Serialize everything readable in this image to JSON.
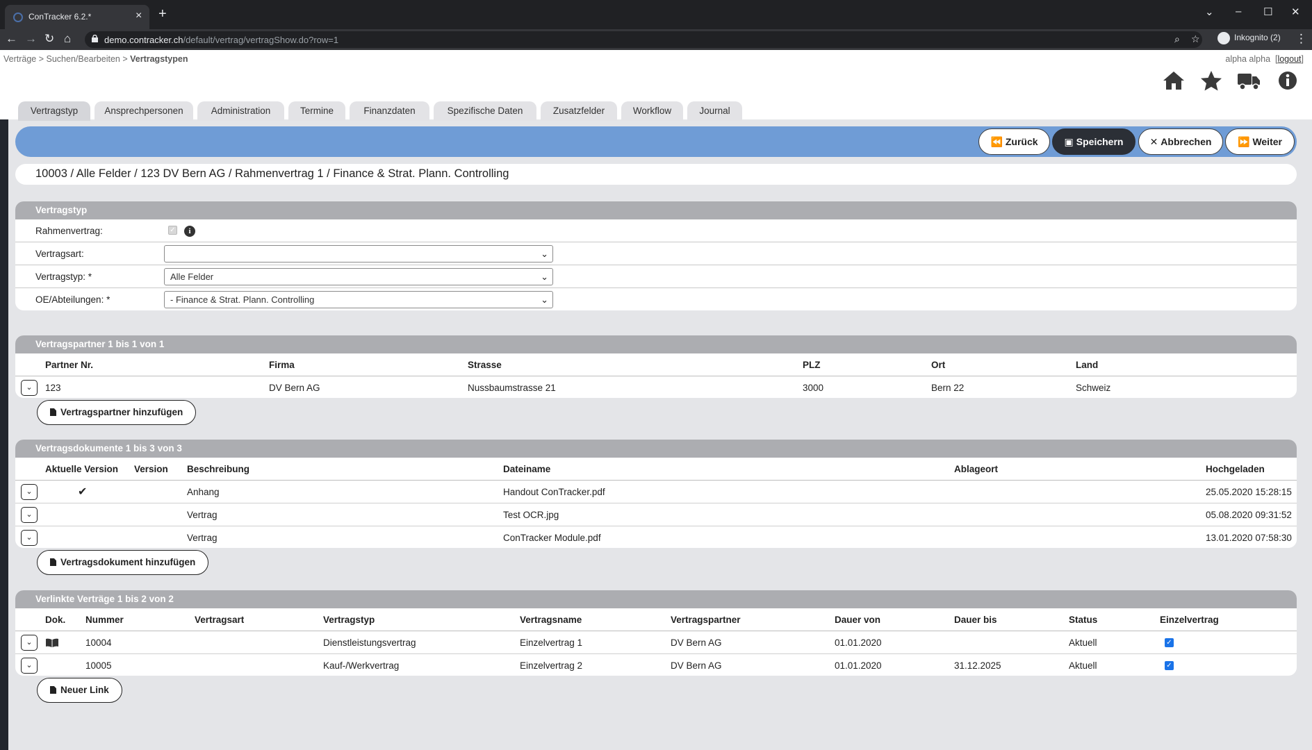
{
  "browser": {
    "tab_title": "ConTracker 6.2.*",
    "url_host": "demo.contracker.ch",
    "url_path": "/default/vertrag/vertragShow.do?row=1",
    "incognito_label": "Inkognito (2)"
  },
  "header": {
    "breadcrumb_1": "Verträge",
    "breadcrumb_2": "Suchen/Bearbeiten",
    "breadcrumb_3": "Vertragstypen",
    "user": "alpha alpha",
    "logout": "logout",
    "icons": [
      "home-icon",
      "star-icon",
      "truck-icon",
      "info-icon"
    ]
  },
  "tabs": [
    "Vertragstyp",
    "Ansprechpersonen",
    "Administration",
    "Termine",
    "Finanzdaten",
    "Spezifische Daten",
    "Zusatzfelder",
    "Workflow",
    "Journal"
  ],
  "actions": {
    "back": "Zurück",
    "save": "Speichern",
    "cancel": "Abbrechen",
    "next": "Weiter"
  },
  "record_title": "10003 / Alle Felder / 123 DV Bern AG / Rahmenvertrag 1 / Finance & Strat. Plann. Controlling",
  "vertragstyp": {
    "heading": "Vertragstyp",
    "rahmenvertrag_label": "Rahmenvertrag:",
    "vertragsart_label": "Vertragsart:",
    "vertragsart_value": "",
    "vertragstyp_label": "Vertragstyp: *",
    "vertragstyp_value": "Alle Felder",
    "oe_label": "OE/Abteilungen: *",
    "oe_value": "- Finance & Strat. Plann. Controlling"
  },
  "partner": {
    "heading": "Vertragspartner 1 bis 1 von 1",
    "columns": [
      "Partner Nr.",
      "Firma",
      "Strasse",
      "PLZ",
      "Ort",
      "Land"
    ],
    "rows": [
      {
        "nr": "123",
        "firma": "DV Bern AG",
        "strasse": "Nussbaumstrasse 21",
        "plz": "3000",
        "ort": "Bern 22",
        "land": "Schweiz"
      }
    ],
    "add_label": "Vertragspartner hinzufügen"
  },
  "documents": {
    "heading": "Vertragsdokumente 1 bis 3 von 3",
    "columns": [
      "Aktuelle Version",
      "Version",
      "Beschreibung",
      "Dateiname",
      "Ablageort",
      "Hochgeladen"
    ],
    "rows": [
      {
        "aktuell": true,
        "beschreibung": "Anhang",
        "dateiname": "Handout ConTracker.pdf",
        "hochgeladen": "25.05.2020 15:28:15"
      },
      {
        "aktuell": false,
        "beschreibung": "Vertrag",
        "dateiname": "Test OCR.jpg",
        "hochgeladen": "05.08.2020 09:31:52"
      },
      {
        "aktuell": false,
        "beschreibung": "Vertrag",
        "dateiname": "ConTracker Module.pdf",
        "hochgeladen": "13.01.2020 07:58:30"
      }
    ],
    "add_label": "Vertragsdokument hinzufügen"
  },
  "linked": {
    "heading": "Verlinkte Verträge 1 bis 2 von 2",
    "columns": [
      "Dok.",
      "Nummer",
      "Vertragsart",
      "Vertragstyp",
      "Vertragsname",
      "Vertragspartner",
      "Dauer von",
      "Dauer bis",
      "Status",
      "Einzelvertrag"
    ],
    "rows": [
      {
        "dok": true,
        "nummer": "10004",
        "vertragstyp": "Dienstleistungsvertrag",
        "name": "Einzelvertrag 1",
        "partner": "DV Bern AG",
        "von": "01.01.2020",
        "bis": "",
        "status": "Aktuell",
        "einzel": true
      },
      {
        "dok": false,
        "nummer": "10005",
        "vertragstyp": "Kauf-/Werkvertrag",
        "name": "Einzelvertrag 2",
        "partner": "DV Bern AG",
        "von": "01.01.2020",
        "bis": "31.12.2025",
        "status": "Aktuell",
        "einzel": true
      }
    ],
    "add_label": "Neuer Link"
  },
  "colors": {
    "action_bar": "#6f9cd6",
    "panel_header": "#acadb1",
    "primary_button": "#2b2f36"
  }
}
